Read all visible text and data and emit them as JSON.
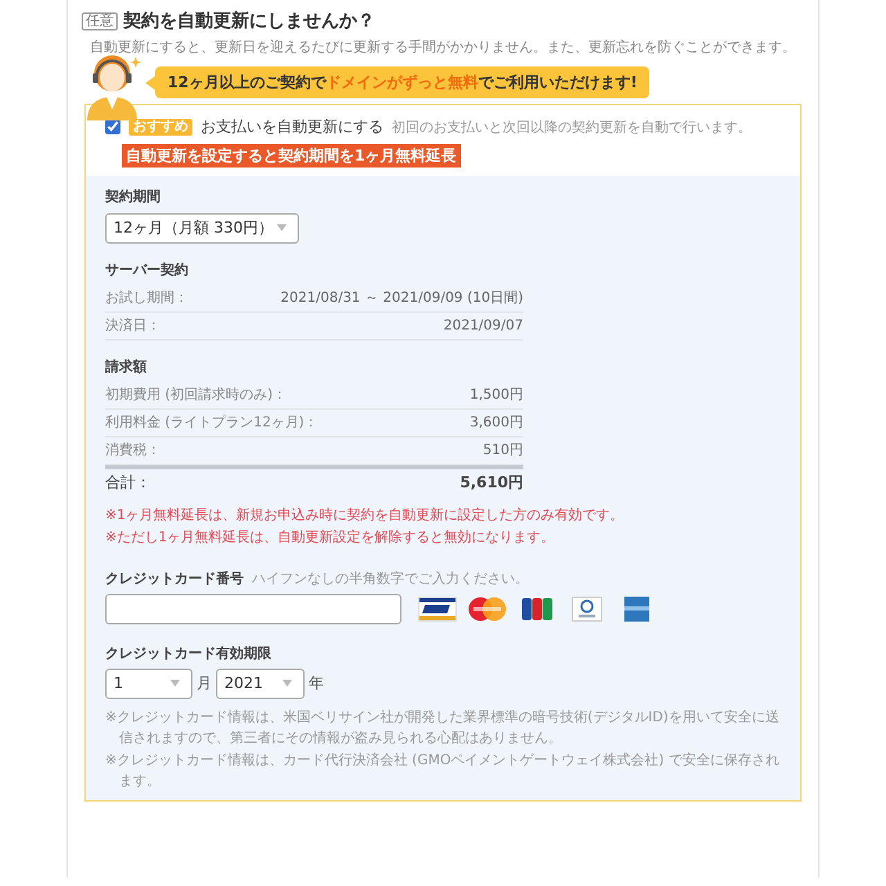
{
  "header": {
    "badge": "任意",
    "title": "契約を自動更新にしませんか？",
    "description": "自動更新にすると、更新日を迎えるたびに更新する手間がかかりません。また、更新忘れを防ぐことができます。"
  },
  "promo": {
    "parts": [
      {
        "text": "12ヶ月以上のご契約で",
        "highlight": false
      },
      {
        "text": "ドメインがずっと無料",
        "highlight": true
      },
      {
        "text": "でご利用いただけます!",
        "highlight": false
      }
    ]
  },
  "auto_renew": {
    "checked": true,
    "badge": "おすすめ",
    "label": "お支払いを自動更新にする",
    "note": "初回のお支払いと次回以降の契約更新を自動で行います。",
    "banner": "自動更新を設定すると契約期間を1ヶ月無料延長"
  },
  "contract_period": {
    "label": "契約期間",
    "value": "12ヶ月（月額 330円）"
  },
  "server_contract": {
    "heading": "サーバー契約",
    "rows": [
      {
        "label": "お試し期間：",
        "value": "2021/08/31 ～ 2021/09/09 (10日間)"
      },
      {
        "label": "決済日：",
        "value": "2021/09/07"
      }
    ]
  },
  "billing": {
    "heading": "請求額",
    "rows": [
      {
        "label": "初期費用 (初回請求時のみ)：",
        "value": "1,500円"
      },
      {
        "label": "利用料金 (ライトプラン12ヶ月)：",
        "value": "3,600円"
      },
      {
        "label": "消費税：",
        "value": "510円"
      }
    ],
    "total": {
      "label": "合計：",
      "value": "5,610円"
    }
  },
  "notices": [
    "※1ヶ月無料延長は、新規お申込み時に契約を自動更新に設定した方のみ有効です。",
    "※ただし1ヶ月無料延長は、自動更新設定を解除すると無効になります。"
  ],
  "card_number": {
    "label": "クレジットカード番号",
    "hint": "ハイフンなしの半角数字でご入力ください。"
  },
  "expiry": {
    "label": "クレジットカード有効期限",
    "month": "1",
    "month_unit": "月",
    "year": "2021",
    "year_unit": "年"
  },
  "footnotes": [
    "※クレジットカード情報は、米国ベリサイン社が開発した業界標準の暗号技術(デジタルID)を用いて安全に送信されますので、第三者にその情報が盗み見られる心配はありません。",
    "※クレジットカード情報は、カード代行決済会社 (GMOペイメントゲートウェイ株式会社) で安全に保存されます。"
  ]
}
